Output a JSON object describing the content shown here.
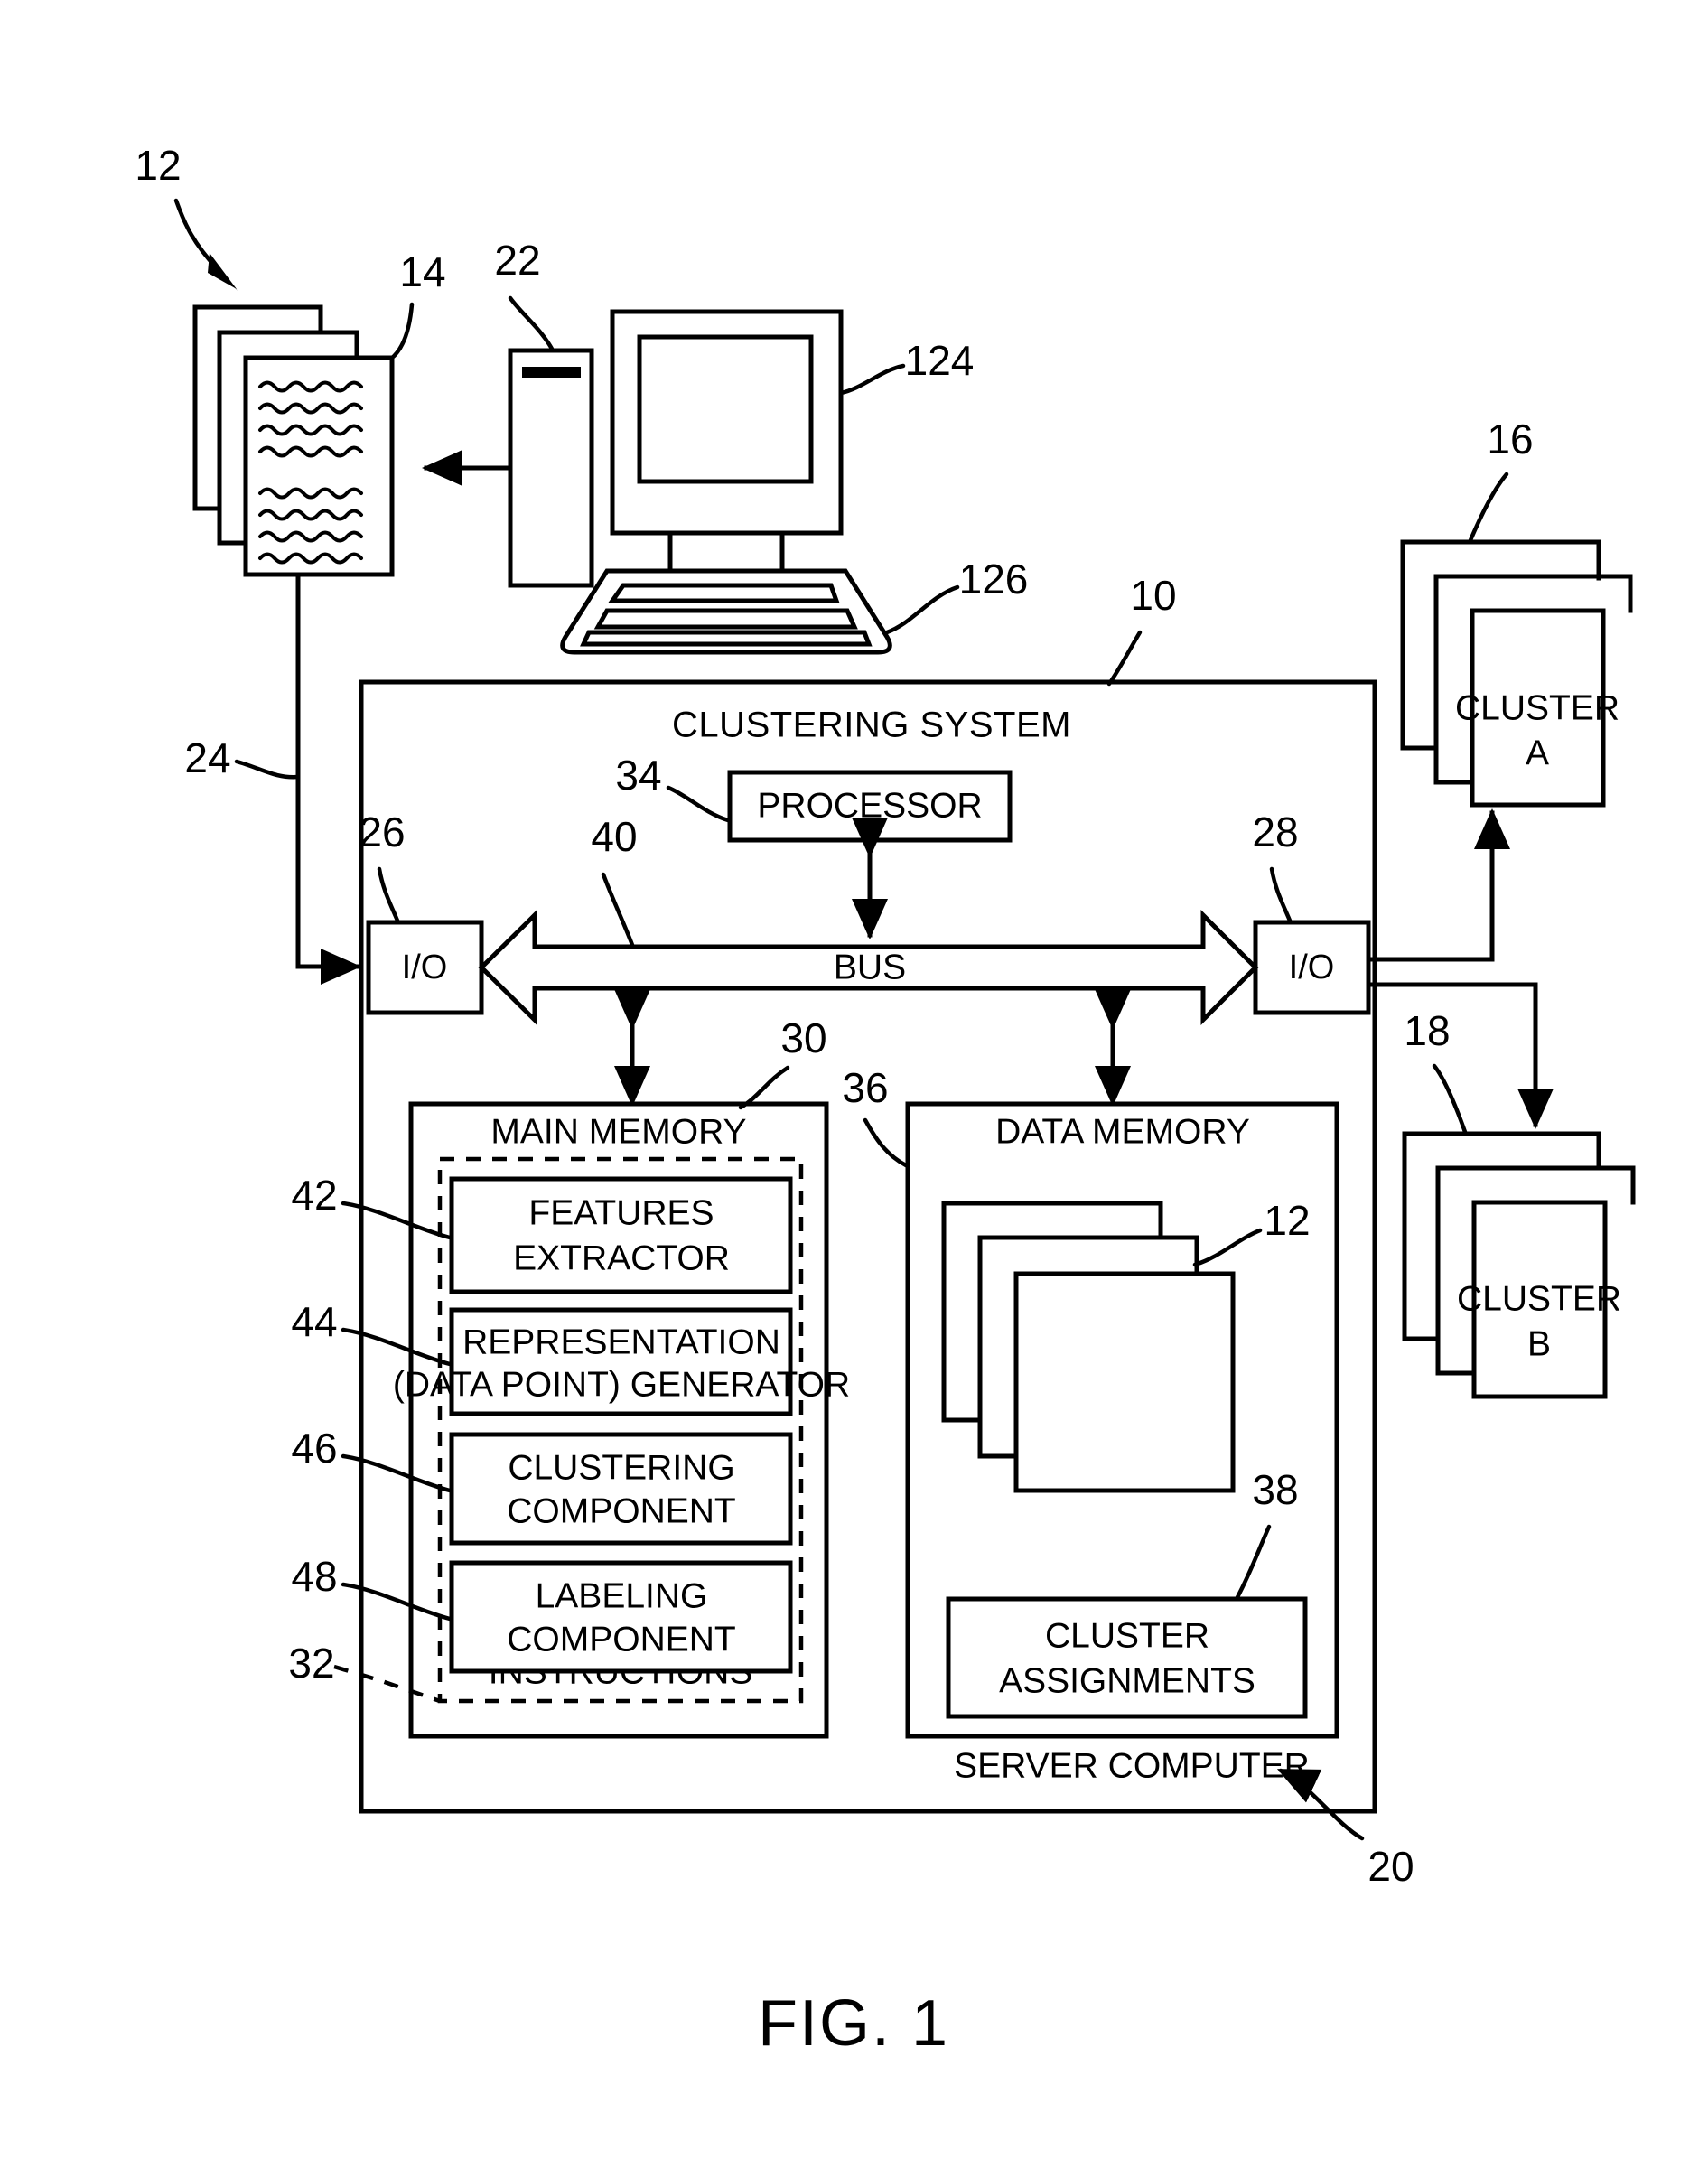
{
  "figure": {
    "caption": "FIG. 1",
    "title_in_box": "CLUSTERING SYSTEM",
    "server_label": "SERVER COMPUTER"
  },
  "reference_numerals": {
    "system_10": "10",
    "documents_12": "12",
    "document_14": "14",
    "clusters_a_16": "16",
    "clusters_b_18": "18",
    "server_20": "20",
    "client_computer_22": "22",
    "link_24": "24",
    "io_in_26": "26",
    "io_out_28": "28",
    "main_memory_30": "30",
    "instructions_32": "32",
    "processor_34": "34",
    "data_memory_36": "36",
    "cluster_assignments_38": "38",
    "bus_40": "40",
    "features_extractor_42": "42",
    "representation_generator_44": "44",
    "clustering_component_46": "46",
    "labeling_component_48": "48",
    "data_points_12": "12",
    "display_124": "124",
    "keyboard_126": "126"
  },
  "blocks": {
    "processor": "PROCESSOR",
    "bus": "BUS",
    "io_left": "I/O",
    "io_right": "I/O",
    "main_memory": "MAIN MEMORY",
    "data_memory": "DATA MEMORY",
    "instructions": "INSTRUCTIONS",
    "features_extractor_line1": "FEATURES",
    "features_extractor_line2": "EXTRACTOR",
    "representation_line1": "REPRESENTATION",
    "representation_line2": "(DATA POINT) GENERATOR",
    "clustering_component_line1": "CLUSTERING",
    "clustering_component_line2": "COMPONENT",
    "labeling_component_line1": "LABELING",
    "labeling_component_line2": "COMPONENT",
    "cluster_assignments_line1": "CLUSTER",
    "cluster_assignments_line2": "ASSIGNMENTS",
    "cluster_a_line1": "CLUSTER",
    "cluster_a_line2": "A",
    "cluster_b_line1": "CLUSTER",
    "cluster_b_line2": "B"
  },
  "colors": {
    "ink": "#000000",
    "paper": "#ffffff"
  }
}
